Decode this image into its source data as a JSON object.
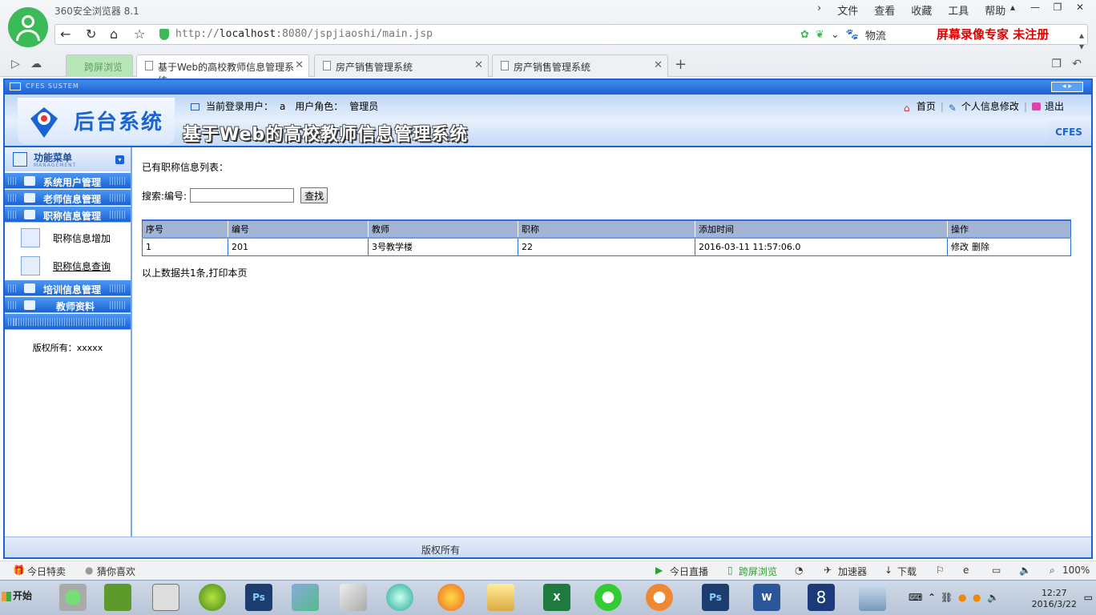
{
  "browser": {
    "name": "360安全浏览器 8.1",
    "menu": [
      "文件",
      "查看",
      "收藏",
      "工具",
      "帮助"
    ],
    "url_prefix": "http://",
    "url_host": "localhost",
    "url_rest": ":8080/jspjiaoshi/main.jsp",
    "search_engine": "物流",
    "record_watermark": "屏幕录像专家 未注册",
    "tabs": [
      {
        "label": "跨屏浏览"
      },
      {
        "label": "基于Web的高校教师信息管理系统"
      },
      {
        "label": "房产销售管理系统"
      },
      {
        "label": "房产销售管理系统"
      }
    ]
  },
  "app": {
    "sys_label": "CFES SUSTEM",
    "logo_text": "后台系统",
    "system_title": "基于Web的高校教师信息管理系统",
    "cfes": "CFES",
    "user": {
      "login_label": "当前登录用户：",
      "login_value": "a",
      "role_label": "用户角色：",
      "role_value": "管理员"
    },
    "links": {
      "home": "首页",
      "profile": "个人信息修改",
      "logout": "退出"
    },
    "sidebar": {
      "title": "功能菜单",
      "subtitle": "MANAGEMENT",
      "items": [
        {
          "label": "系统用户管理"
        },
        {
          "label": "老师信息管理"
        },
        {
          "label": "职称信息管理"
        }
      ],
      "subitems": [
        {
          "label": "职称信息增加"
        },
        {
          "label": "职称信息查询"
        }
      ],
      "items2": [
        {
          "label": "培训信息管理"
        },
        {
          "label": "教师资料"
        }
      ],
      "copyright": "版权所有：xxxxx"
    },
    "content": {
      "list_title": "已有职称信息列表：",
      "search_label": "搜索:编号:",
      "search_value": "",
      "search_button": "查找",
      "columns": [
        "序号",
        "编号",
        "教师",
        "职称",
        "添加时间",
        "操作"
      ],
      "rows": [
        {
          "seq": "1",
          "code": "201",
          "teacher": "3号教学楼",
          "title": "22",
          "time": "2016-03-11 11:57:06.0",
          "edit": "修改",
          "delete": "删除"
        }
      ],
      "summary": "以上数据共1条,打印本页"
    },
    "footer": "版权所有"
  },
  "statusbar": {
    "left": [
      "今日特卖",
      "猜你喜欢"
    ],
    "right": [
      "今日直播",
      "跨屏浏览",
      "加速器",
      "下载",
      "100%"
    ]
  },
  "taskbar": {
    "start": "开始",
    "clock_time": "12:27",
    "clock_date": "2016/3/22"
  },
  "colors": {
    "accent": "#1a63d3",
    "header_bg": "#a3b4d4"
  }
}
